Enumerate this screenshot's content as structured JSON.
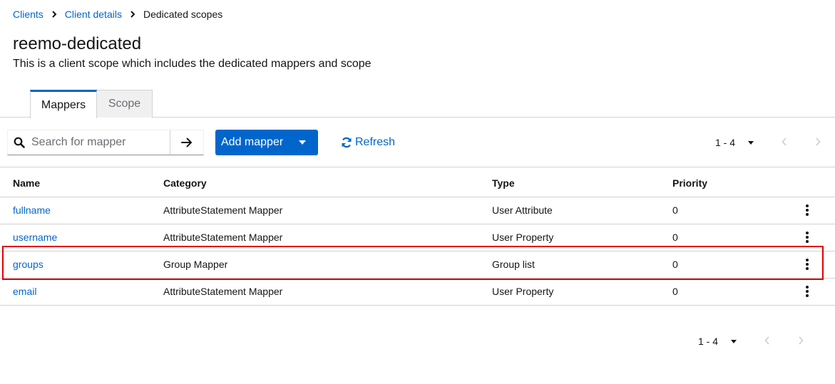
{
  "breadcrumb": {
    "items": [
      "Clients",
      "Client details"
    ],
    "current": "Dedicated scopes"
  },
  "page": {
    "title": "reemo-dedicated",
    "description": "This is a client scope which includes the dedicated mappers and scope"
  },
  "tabs": [
    {
      "label": "Mappers",
      "active": true
    },
    {
      "label": "Scope",
      "active": false
    }
  ],
  "toolbar": {
    "search_placeholder": "Search for mapper",
    "add_label": "Add mapper",
    "refresh_label": "Refresh"
  },
  "pagination": {
    "range_top": "1 - 4",
    "range_bottom": "1 - 4"
  },
  "table": {
    "headers": {
      "name": "Name",
      "category": "Category",
      "type": "Type",
      "priority": "Priority"
    },
    "rows": [
      {
        "name": "fullname",
        "category": "AttributeStatement Mapper",
        "type": "User Attribute",
        "priority": "0"
      },
      {
        "name": "username",
        "category": "AttributeStatement Mapper",
        "type": "User Property",
        "priority": "0"
      },
      {
        "name": "groups",
        "category": "Group Mapper",
        "type": "Group list",
        "priority": "0",
        "highlighted": true
      },
      {
        "name": "email",
        "category": "AttributeStatement Mapper",
        "type": "User Property",
        "priority": "0"
      }
    ]
  },
  "colors": {
    "accent": "#0066cc",
    "highlight": "#e00000"
  }
}
